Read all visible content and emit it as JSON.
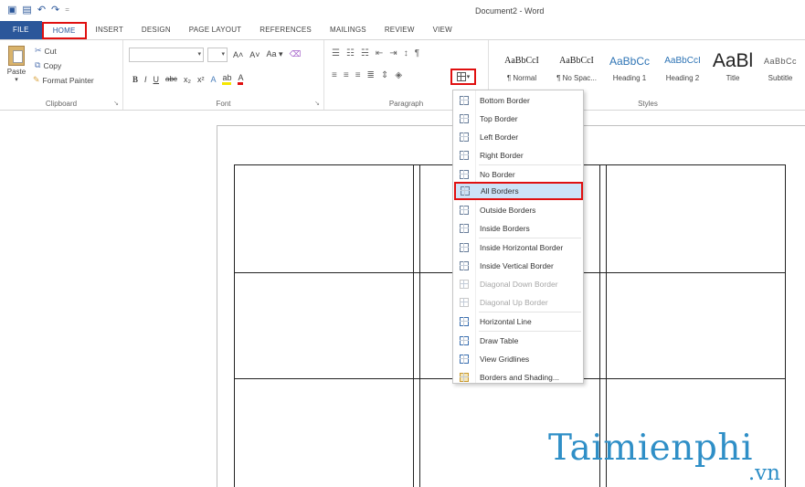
{
  "window": {
    "title": "Document2 - Word"
  },
  "qat": {
    "icons": [
      "word-logo-icon",
      "save-icon",
      "undo-icon",
      "redo-icon",
      "customize-icon"
    ]
  },
  "tabs": [
    {
      "label": "FILE"
    },
    {
      "label": "HOME"
    },
    {
      "label": "INSERT"
    },
    {
      "label": "DESIGN"
    },
    {
      "label": "PAGE LAYOUT"
    },
    {
      "label": "REFERENCES"
    },
    {
      "label": "MAILINGS"
    },
    {
      "label": "REVIEW"
    },
    {
      "label": "VIEW"
    }
  ],
  "clipboard": {
    "label": "Clipboard",
    "paste": "Paste",
    "cut": "Cut",
    "copy": "Copy",
    "format_painter": "Format Painter"
  },
  "font": {
    "label": "Font",
    "name_value": "",
    "size_value": "",
    "row1": {
      "grow": "A˄",
      "shrink": "A˅",
      "case": "Aa ▾",
      "clear": "⌫"
    },
    "row2": {
      "bold": "B",
      "italic": "I",
      "underline": "U",
      "strike": "abc",
      "sub": "x₂",
      "sup": "x²",
      "effects": "A",
      "highlight": "ab",
      "color": "A"
    }
  },
  "paragraph": {
    "label": "Paragraph"
  },
  "styles": {
    "label": "Styles",
    "items": [
      {
        "sample": "AaBbCcI",
        "name": "¶ Normal"
      },
      {
        "sample": "AaBbCcI",
        "name": "¶ No Spac..."
      },
      {
        "sample": "AaBbCc",
        "name": "Heading 1"
      },
      {
        "sample": "AaBbCcI",
        "name": "Heading 2"
      },
      {
        "sample": "AaBl",
        "name": "Title"
      },
      {
        "sample": "AaBbCc",
        "name": "Subtitle"
      }
    ]
  },
  "border_menu": {
    "items": [
      {
        "label": "Bottom Border",
        "enabled": true
      },
      {
        "label": "Top Border",
        "enabled": true
      },
      {
        "label": "Left Border",
        "enabled": true
      },
      {
        "label": "Right Border",
        "enabled": true
      },
      {
        "label": "No Border",
        "enabled": true
      },
      {
        "label": "All Borders",
        "enabled": true,
        "highlighted": true
      },
      {
        "label": "Outside Borders",
        "enabled": true
      },
      {
        "label": "Inside Borders",
        "enabled": true
      },
      {
        "label": "Inside Horizontal Border",
        "enabled": true
      },
      {
        "label": "Inside Vertical Border",
        "enabled": true
      },
      {
        "label": "Diagonal Down Border",
        "enabled": false
      },
      {
        "label": "Diagonal Up Border",
        "enabled": false
      },
      {
        "label": "Horizontal Line",
        "enabled": true
      },
      {
        "label": "Draw Table",
        "enabled": true
      },
      {
        "label": "View Gridlines",
        "enabled": true
      },
      {
        "label": "Borders and Shading...",
        "enabled": true
      }
    ]
  },
  "watermark": {
    "main": "Taimienphi",
    "sub": ".vn"
  },
  "colors": {
    "accent": "#2b579a",
    "highlight_box": "#e01010",
    "watermark": "#2f8fc7",
    "menu_hover": "#cde3f7"
  }
}
